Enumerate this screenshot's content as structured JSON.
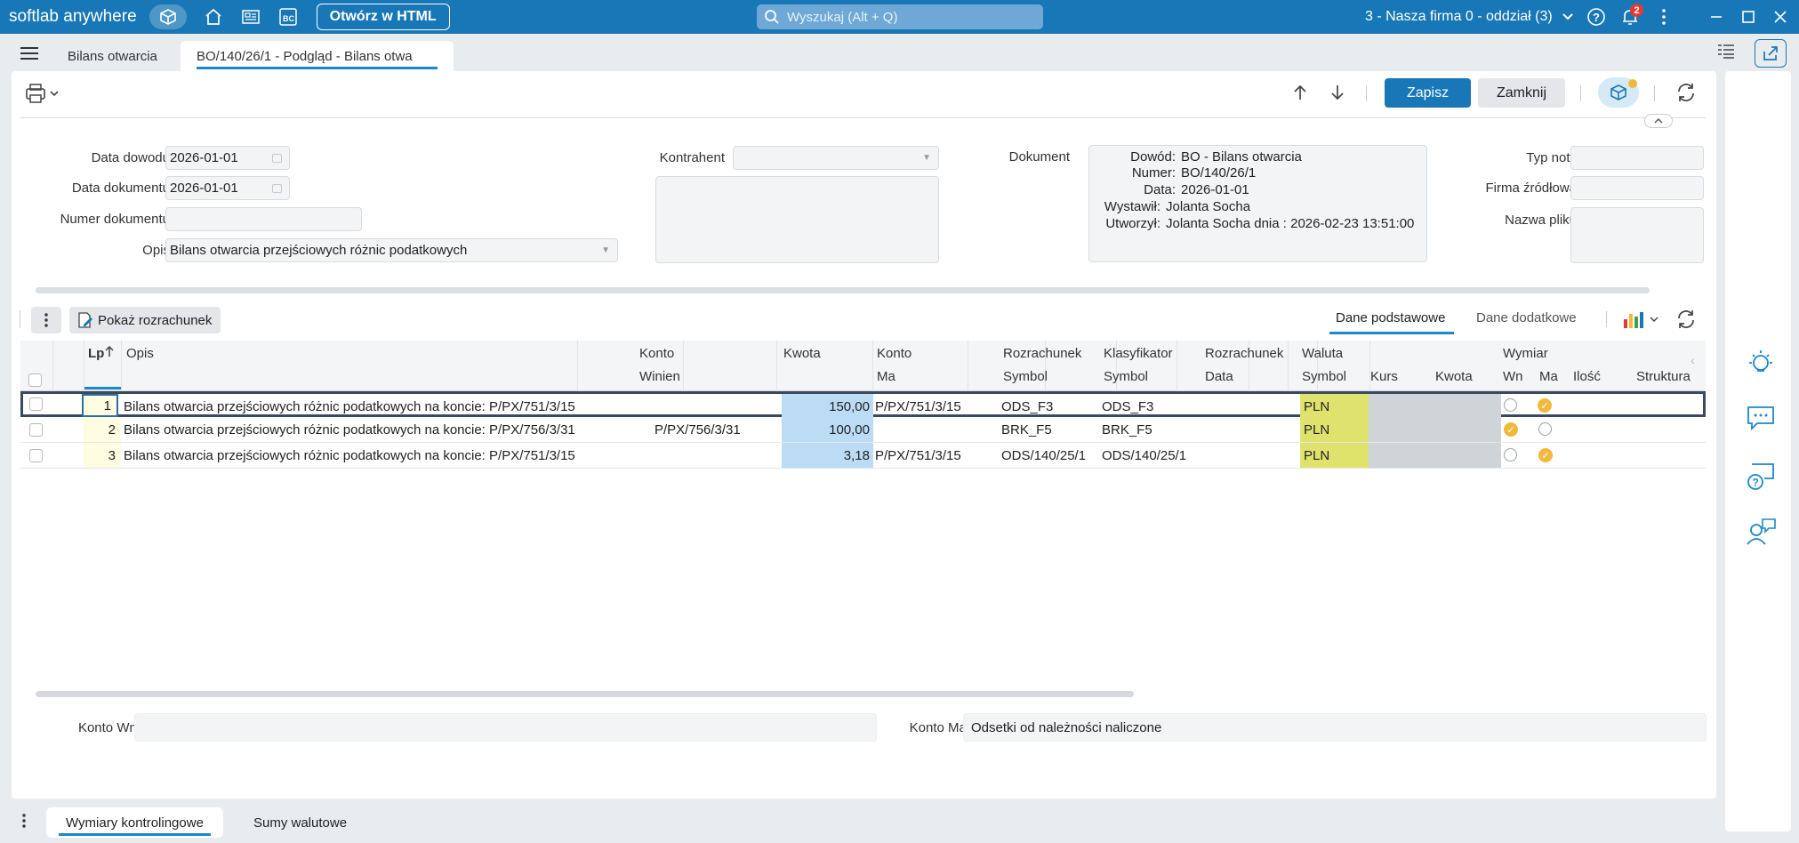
{
  "topbar": {
    "brand": "softlab anywhere",
    "open_html": "Otwórz w HTML",
    "search_placeholder": "Wyszukaj (Alt + Q)",
    "company": "3 - Nasza firma 0 - oddział (3)",
    "notifications": "2"
  },
  "tabs": [
    {
      "label": "Bilans otwarcia"
    },
    {
      "label": "BO/140/26/1 - Podgląd - Bilans otwa"
    }
  ],
  "toolbar": {
    "save": "Zapisz",
    "close": "Zamknij"
  },
  "form": {
    "data_dowodu_label": "Data dowodu",
    "data_dowodu": "2026-01-01",
    "data_dokumentu_label": "Data dokumentu",
    "data_dokumentu": "2026-01-01",
    "numer_dokumentu_label": "Numer dokumentu",
    "numer_dokumentu": "",
    "opis_label": "Opis",
    "opis": "Bilans otwarcia przejściowych różnic podatkowych",
    "kontrahent_label": "Kontrahent",
    "dokument_label": "Dokument",
    "typ_noty_label": "Typ noty",
    "firma_zrodlowa_label": "Firma źródłowa",
    "nazwa_pliku_label": "Nazwa pliku"
  },
  "document": {
    "dowod_k": "Dowód:",
    "dowod_v": "BO - Bilans otwarcia",
    "numer_k": "Numer:",
    "numer_v": "BO/140/26/1",
    "data_k": "Data:",
    "data_v": "2026-01-01",
    "wystawil_k": "Wystawił:",
    "wystawil_v": "Jolanta Socha",
    "utworzyl_k": "Utworzył:",
    "utworzyl_v": "Jolanta Socha dnia : 2026-02-23 13:51:00"
  },
  "grid_toolbar": {
    "show_settlement": "Pokaż rozrachunek",
    "tab_basic": "Dane podstawowe",
    "tab_extra": "Dane dodatkowe"
  },
  "grid": {
    "headers": {
      "lp": "Lp",
      "opis": "Opis",
      "konto": "Konto",
      "winien": "Winien",
      "kwota": "Kwota",
      "konto2": "Konto",
      "ma": "Ma",
      "rozrachunek": "Rozrachunek",
      "symbol": "Symbol",
      "klasyfikator": "Klasyfikator",
      "symbol2": "Symbol",
      "rozrachunek2": "Rozrachunek",
      "data": "Data",
      "waluta": "Waluta",
      "symbol3": "Symbol",
      "kurs": "Kurs",
      "kwota2": "Kwota",
      "wymiar": "Wymiar",
      "wn": "Wn",
      "ma2": "Ma",
      "ilosc": "Ilość",
      "struktura": "Struktura"
    },
    "rows": [
      {
        "lp": "1",
        "opis": "Bilans otwarcia przejściowych różnic podatkowych na koncie: P/PX/751/3/15",
        "winien": "",
        "kwota": "150,00",
        "ma": "P/PX/751/3/15",
        "rozr_symbol": "ODS_F3",
        "klas_symbol": "ODS_F3",
        "waluta": "PLN",
        "wn": false,
        "ma_checked": true
      },
      {
        "lp": "2",
        "opis": "Bilans otwarcia przejściowych różnic podatkowych na koncie: P/PX/756/3/31",
        "winien": "P/PX/756/3/31",
        "kwota": "100,00",
        "ma": "",
        "rozr_symbol": "BRK_F5",
        "klas_symbol": "BRK_F5",
        "waluta": "PLN",
        "wn": true,
        "ma_checked": false
      },
      {
        "lp": "3",
        "opis": "Bilans otwarcia przejściowych różnic podatkowych na koncie: P/PX/751/3/15",
        "winien": "",
        "kwota": "3,18",
        "ma": "P/PX/751/3/15",
        "rozr_symbol": "ODS/140/25/1",
        "klas_symbol": "ODS/140/25/1",
        "waluta": "PLN",
        "wn": false,
        "ma_checked": true
      }
    ]
  },
  "footer": {
    "konto_wn_label": "Konto Wn:",
    "konto_wn": "",
    "konto_ma_label": "Konto Ma:",
    "konto_ma": "Odsetki od należności naliczone"
  },
  "bottom_tabs": [
    {
      "label": "Wymiary kontrolingowe"
    },
    {
      "label": "Sumy walutowe"
    }
  ],
  "colors": {
    "accent": "#1877b6",
    "amount_bg": "#bcdcf5",
    "currency_bg": "#dfe36e",
    "lp_bg": "#fffde1"
  }
}
